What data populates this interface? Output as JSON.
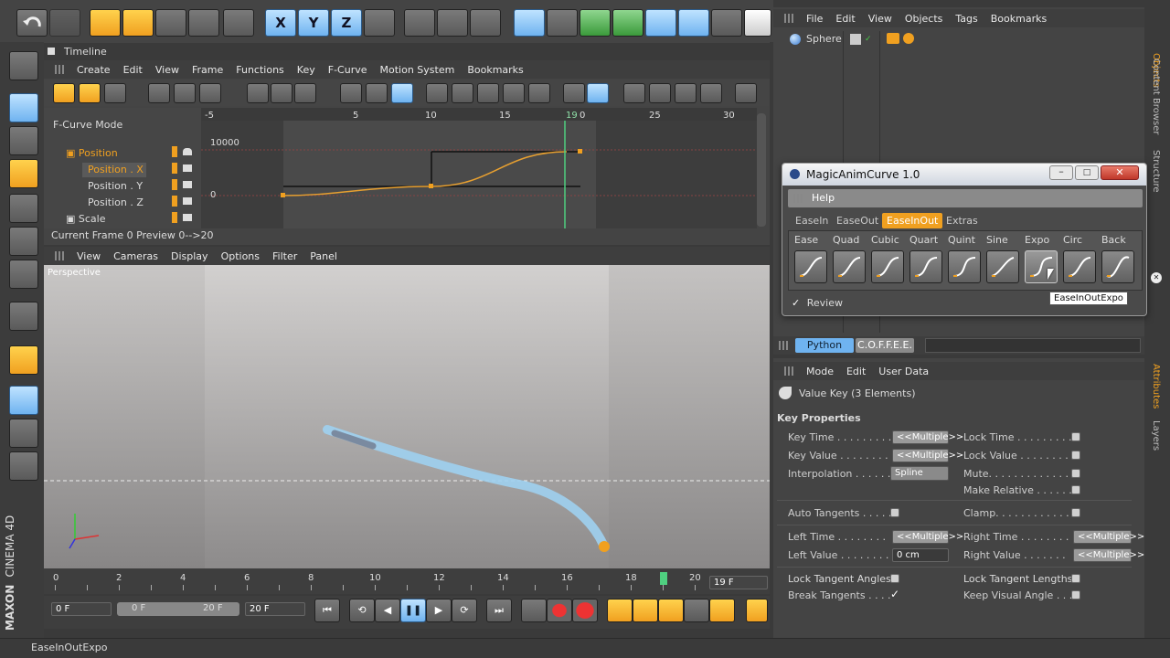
{
  "timeline": {
    "title": "Timeline",
    "menu": [
      "Create",
      "Edit",
      "View",
      "Frame",
      "Functions",
      "Key",
      "F-Curve",
      "Motion System",
      "Bookmarks"
    ],
    "mode": "F-Curve Mode",
    "ruler": [
      "-5",
      "5",
      "10",
      "15",
      "19",
      "0",
      "25",
      "30"
    ],
    "tracks": [
      "Position",
      "Position . X",
      "Position . Y",
      "Position . Z",
      "Scale"
    ],
    "value_labels": [
      "10000",
      "0"
    ],
    "status": "Current Frame  0  Preview  0-->20"
  },
  "viewport": {
    "menu": [
      "View",
      "Cameras",
      "Display",
      "Options",
      "Filter",
      "Panel"
    ],
    "label": "Perspective"
  },
  "frame_ruler": [
    "0",
    "2",
    "4",
    "6",
    "8",
    "10",
    "12",
    "14",
    "16",
    "18",
    "20"
  ],
  "transport": {
    "current": "19 F",
    "start": "0 F",
    "range_start": "0 F",
    "range_end": "20 F",
    "end": "20 F"
  },
  "brand": {
    "line1": "MAXON",
    "line2": "CINEMA 4D"
  },
  "objects": {
    "menu": [
      "File",
      "Edit",
      "View",
      "Objects",
      "Tags",
      "Bookmarks"
    ],
    "item": "Sphere"
  },
  "side_tabs": [
    "Objects",
    "Content Browser",
    "Structure",
    "Attributes",
    "Layers"
  ],
  "magic": {
    "title": "MagicAnimCurve 1.0",
    "help": "Help",
    "tabs": [
      "EaseIn",
      "EaseOut",
      "EaseInOut",
      "Extras"
    ],
    "active_tab": "EaseInOut",
    "curves": [
      "Ease",
      "Quad",
      "Cubic",
      "Quart",
      "Quint",
      "Sine",
      "Expo",
      "Circ",
      "Back"
    ],
    "review_check": "✓",
    "review": "Review",
    "tooltip": "EaseInOutExpo"
  },
  "script_tabs": [
    "Python",
    "C.O.F.F.E.E."
  ],
  "attributes": {
    "menu": [
      "Mode",
      "Edit",
      "User Data"
    ],
    "header": "Value Key (3 Elements)",
    "section": "Key Properties",
    "multi": "<<Multiple>>",
    "left_props": [
      {
        "label": "Key Time . . . . . . . . . .",
        "value": "<<Multiple>>"
      },
      {
        "label": "Key Value . . . . . . . . .",
        "value": "<<Multiple>>"
      },
      {
        "label": "Interpolation . . . . . . .",
        "value": "Spline"
      }
    ],
    "right_props": [
      "Lock Time . . . . . . . . .",
      "Lock Value . . . . . . . .",
      "Mute. . . . . . . . . . . . .",
      "Make Relative . . . . . ."
    ],
    "auto_tangents": "Auto Tangents . . . . .",
    "clamp": "Clamp. . . . . . . . . . . .",
    "left_time": "Left  Time . . . . . . . .",
    "left_value": "Left  Value . . . . . . . .",
    "left_value_v": "0 cm",
    "right_time": "Right Time . . . . . . . .",
    "right_value": "Right Value . . . . . . .",
    "lock_tangent_angles": "Lock Tangent Angles",
    "lock_tangent_lengths": "Lock Tangent Lengths",
    "break_tangents": "Break Tangents . . . .",
    "break_check": "✓",
    "keep_visual": "Keep Visual Angle . . ."
  },
  "status_bar": "EaseInOutExpo",
  "colors": {
    "accent": "#f0a020",
    "curve": "#e8a030",
    "select": "#6fb3f0"
  }
}
